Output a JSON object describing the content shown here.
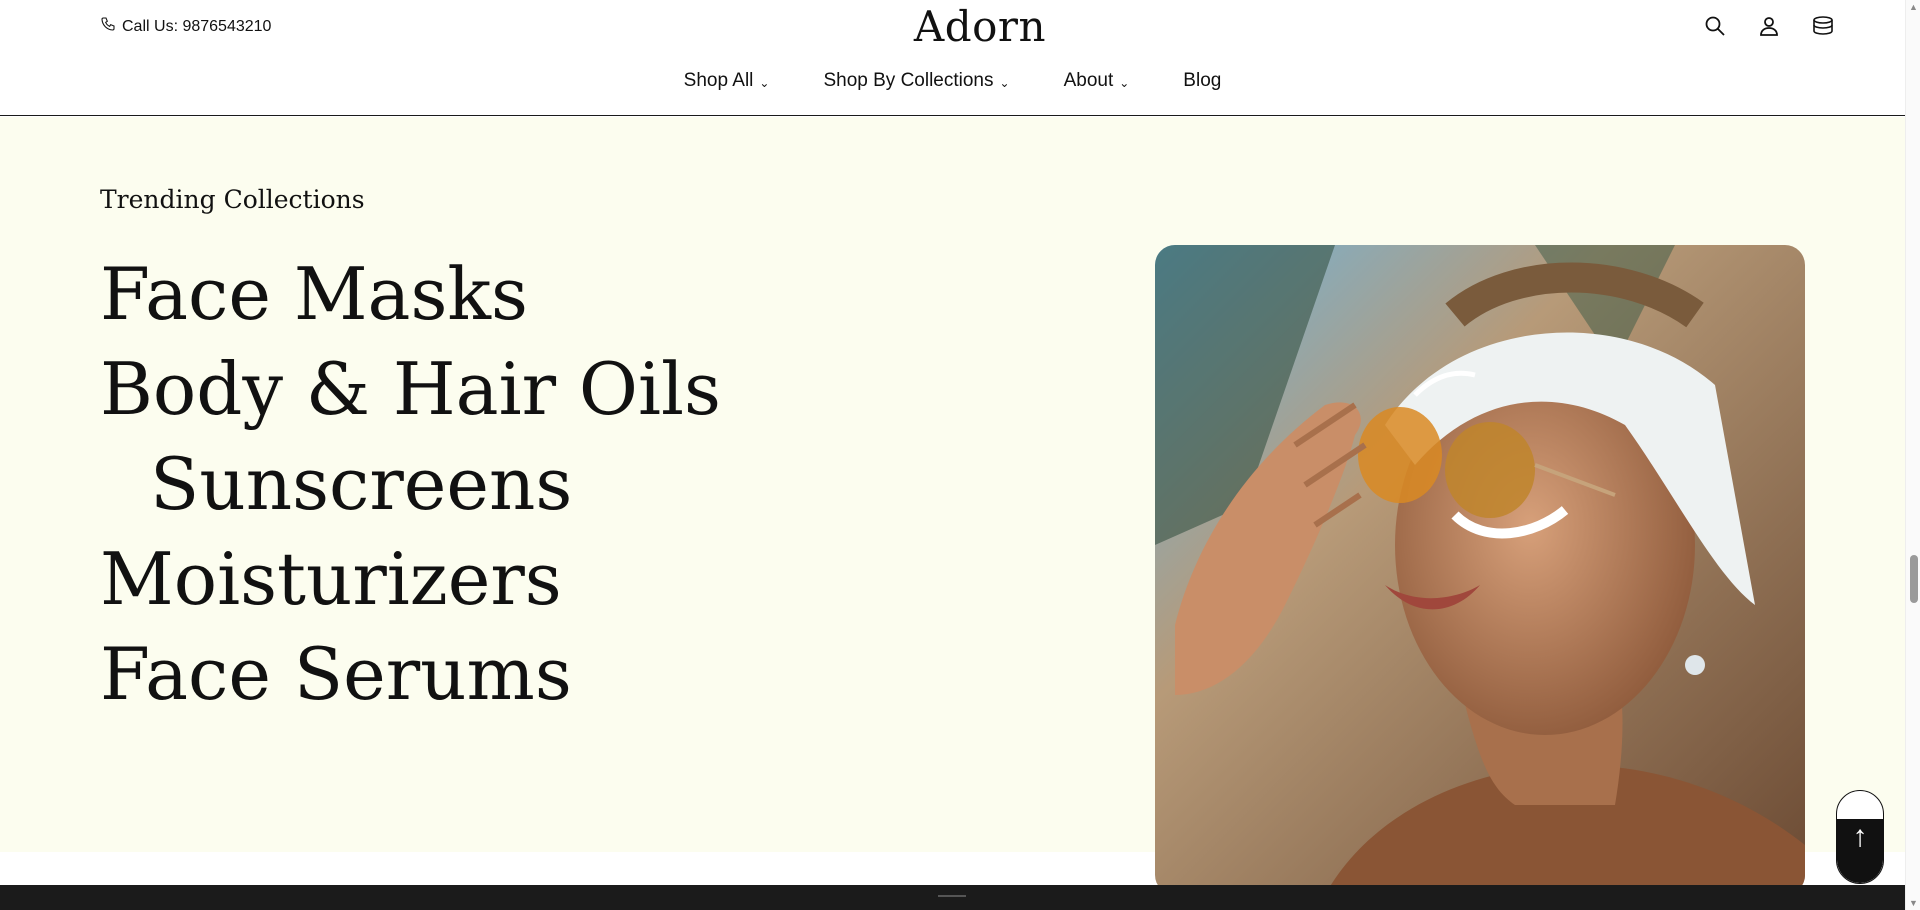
{
  "header": {
    "phone_text": "Call Us: 9876543210",
    "logo": "Adorn",
    "icons": [
      "search-icon",
      "account-icon",
      "cart-icon"
    ]
  },
  "nav": {
    "items": [
      {
        "label": "Shop All",
        "has_dropdown": true
      },
      {
        "label": "Shop By Collections",
        "has_dropdown": true
      },
      {
        "label": "About",
        "has_dropdown": true
      },
      {
        "label": "Blog",
        "has_dropdown": false
      }
    ]
  },
  "section": {
    "eyebrow": "Trending Collections",
    "collections": [
      "Face Masks",
      "Body & Hair Oils",
      "Sunscreens",
      "Moisturizers",
      "Face Serums"
    ],
    "background": "#fcfdef"
  },
  "colors": {
    "text": "#111111",
    "footer": "#1b1b1b"
  },
  "scroll_top": {
    "icon": "arrow-up-icon"
  }
}
